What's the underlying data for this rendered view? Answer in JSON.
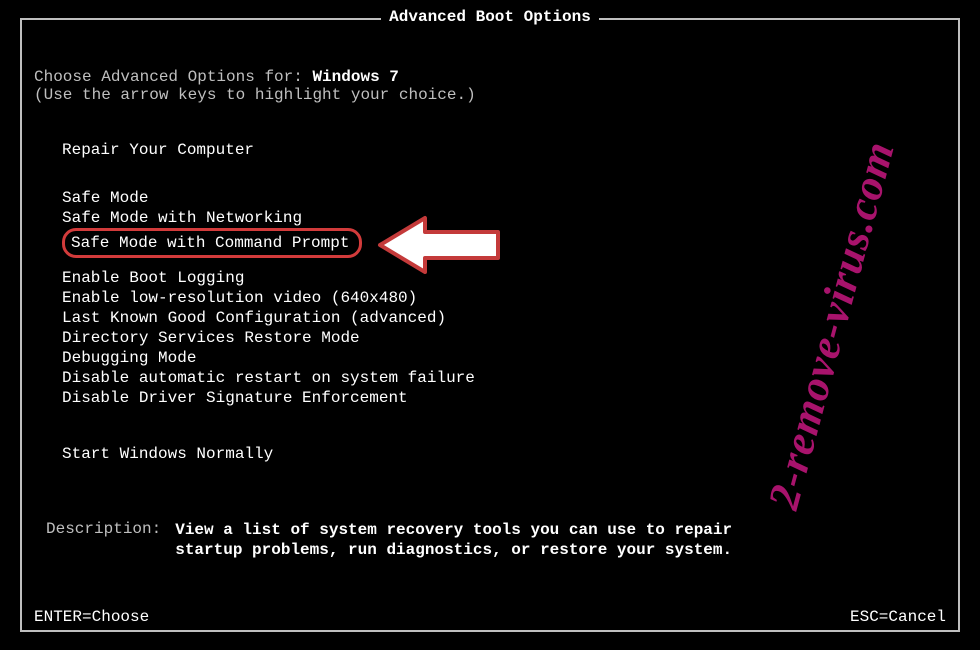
{
  "title": "Advanced Boot Options",
  "choose_prefix": "Choose Advanced Options for: ",
  "os_name": "Windows 7",
  "hint": "(Use the arrow keys to highlight your choice.)",
  "groups": {
    "repair": "Repair Your Computer",
    "safe": [
      "Safe Mode",
      "Safe Mode with Networking",
      "Safe Mode with Command Prompt"
    ],
    "advanced": [
      "Enable Boot Logging",
      "Enable low-resolution video (640x480)",
      "Last Known Good Configuration (advanced)",
      "Directory Services Restore Mode",
      "Debugging Mode",
      "Disable automatic restart on system failure",
      "Disable Driver Signature Enforcement"
    ],
    "normal": "Start Windows Normally"
  },
  "description": {
    "label": "Description:",
    "text": "View a list of system recovery tools you can use to repair startup problems, run diagnostics, or restore your system."
  },
  "footer": {
    "enter": "ENTER=Choose",
    "esc": "ESC=Cancel"
  },
  "watermark": "2-remove-virus.com"
}
